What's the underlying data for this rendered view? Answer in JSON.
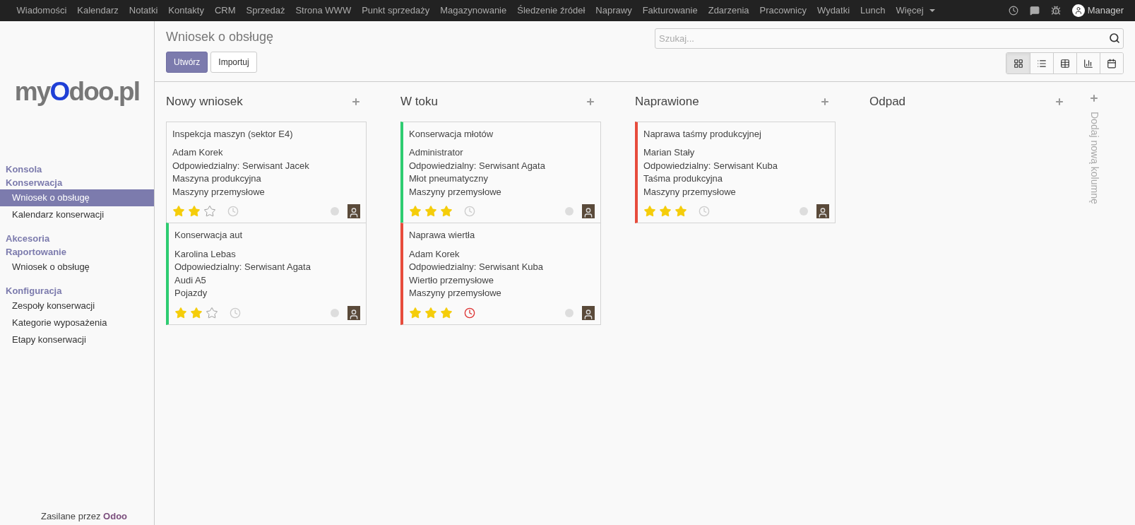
{
  "top_menu": [
    "Wiadomości",
    "Kalendarz",
    "Notatki",
    "Kontakty",
    "CRM",
    "Sprzedaż",
    "Strona WWW",
    "Punkt sprzedaży",
    "Magazynowanie",
    "Śledzenie źródeł",
    "Naprawy",
    "Fakturowanie",
    "Zdarzenia",
    "Pracownicy",
    "Wydatki",
    "Lunch"
  ],
  "more_menu": "Więcej",
  "user": "Manager",
  "logo": {
    "prefix": "my",
    "mark": "O",
    "suffix": "doo.pl"
  },
  "sidebar": [
    {
      "kind": "heading",
      "label": "Konsola"
    },
    {
      "kind": "heading",
      "label": "Konserwacja"
    },
    {
      "kind": "item",
      "label": "Wniosek o obsługę",
      "selected": true
    },
    {
      "kind": "item",
      "label": "Kalendarz konserwacji",
      "selected": false
    },
    {
      "kind": "heading",
      "label": "Akcesoria"
    },
    {
      "kind": "heading",
      "label": "Raportowanie"
    },
    {
      "kind": "item",
      "label": "Wniosek o obsługę",
      "selected": false
    },
    {
      "kind": "heading",
      "label": "Konfiguracja"
    },
    {
      "kind": "item",
      "label": "Zespoły konserwacji",
      "selected": false
    },
    {
      "kind": "item",
      "label": "Kategorie wyposażenia",
      "selected": false
    },
    {
      "kind": "item",
      "label": "Etapy konserwacji",
      "selected": false
    }
  ],
  "footer": {
    "text": "Zasilane przez",
    "brand": "Odoo"
  },
  "page_title": "Wniosek o obsługę",
  "buttons": [
    {
      "label": "Utwórz",
      "kind": "primary"
    },
    {
      "label": "Importuj",
      "kind": "default"
    }
  ],
  "search": {
    "placeholder": "Szukaj..."
  },
  "views": [
    {
      "kind": "kanban",
      "selected": true
    },
    {
      "kind": "list",
      "selected": false
    },
    {
      "kind": "grid",
      "selected": false
    },
    {
      "kind": "graph",
      "selected": false
    },
    {
      "kind": "calendar",
      "selected": false
    }
  ],
  "columns": [
    {
      "title": "Nowy wniosek",
      "cards": [
        {
          "title": "Inspekcja maszyn (sektor E4)",
          "lines": [
            "Adam Korek",
            "Odpowiedzialny: Serwisant Jacek",
            "Maszyna produkcyjna",
            "Maszyny przemysłowe"
          ],
          "stars": 2,
          "overdue": false
        },
        {
          "title": "Konserwacja aut",
          "color": "#2ecc71",
          "lines": [
            "Karolina Lebas",
            "Odpowiedzialny: Serwisant Agata",
            "Audi A5",
            "Pojazdy"
          ],
          "stars": 2,
          "overdue": false
        }
      ]
    },
    {
      "title": "W toku",
      "cards": [
        {
          "title": "Konserwacja młotów",
          "color": "#2ecc71",
          "lines": [
            "Administrator",
            "Odpowiedzialny: Serwisant Agata",
            "Młot pneumatyczny",
            "Maszyny przemysłowe"
          ],
          "stars": 3,
          "overdue": false
        },
        {
          "title": "Naprawa wiertła",
          "color": "#e74c3c",
          "lines": [
            "Adam Korek",
            "Odpowiedzialny: Serwisant Kuba",
            "Wiertło przemysłowe",
            "Maszyny przemysłowe"
          ],
          "stars": 3,
          "overdue": true
        }
      ]
    },
    {
      "title": "Naprawione",
      "cards": [
        {
          "title": "Naprawa taśmy produkcyjnej",
          "color": "#e74c3c",
          "lines": [
            "Marian Stały",
            "Odpowiedzialny: Serwisant Kuba",
            "Taśma produkcyjna",
            "Maszyny przemysłowe"
          ],
          "stars": 3,
          "overdue": false
        }
      ]
    },
    {
      "title": "Odpad"
    }
  ],
  "add_column": "Dodaj nową kolumnę"
}
